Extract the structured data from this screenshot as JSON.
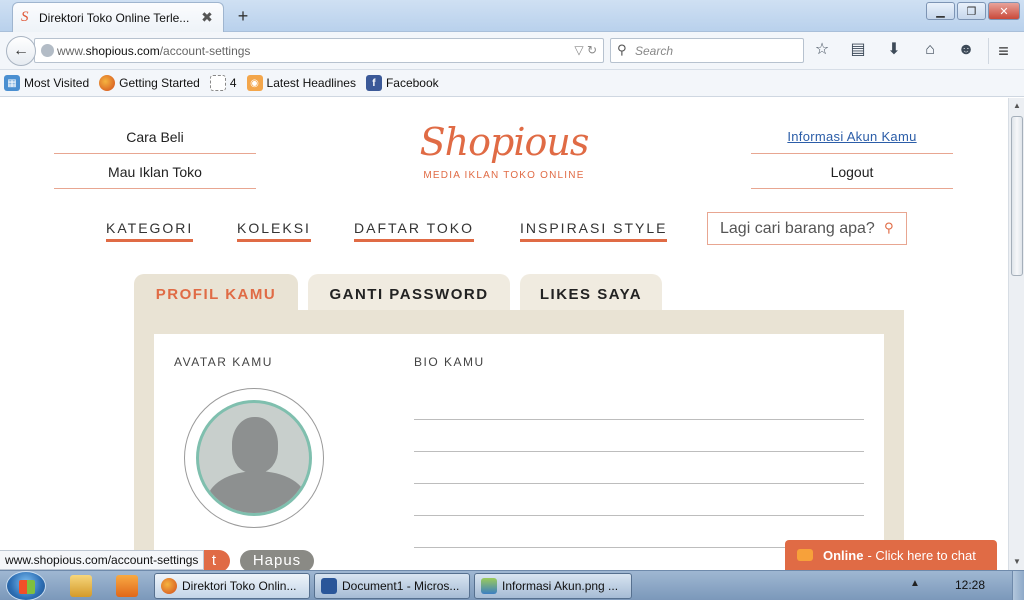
{
  "browser": {
    "tab_title": "Direktori Toko Online Terle...",
    "tab_favicon": "S",
    "tab_close": "✖",
    "new_tab": "+",
    "url_prefix": "www.",
    "url_host": "shopious.com",
    "url_path": "/account-settings",
    "search_placeholder": "Search",
    "bookmarks": [
      {
        "label": "Most Visited",
        "icon": "most-visited-icon"
      },
      {
        "label": "Getting Started",
        "icon": "firefox-icon"
      },
      {
        "label": "4",
        "icon": "folder-icon"
      },
      {
        "label": "Latest Headlines",
        "icon": "rss-icon"
      },
      {
        "label": "Facebook",
        "icon": "facebook-icon"
      }
    ],
    "status_url": "www.shopious.com/account-settings"
  },
  "site": {
    "left_links": [
      "Cara Beli",
      "Mau Iklan Toko"
    ],
    "right_links": [
      "Informasi Akun Kamu",
      "Logout"
    ],
    "logo_text": "Shopious",
    "tagline": "MEDIA IKLAN TOKO ONLINE",
    "nav": [
      "KATEGORI",
      "KOLEKSI",
      "DAFTAR TOKO",
      "INSPIRASI STYLE"
    ],
    "search_placeholder": "Lagi cari barang apa?",
    "profile_tabs": [
      "PROFIL KAMU",
      "GANTI PASSWORD",
      "LIKES SAYA"
    ],
    "avatar_label": "AVATAR KAMU",
    "bio_label": "BIO KAMU",
    "edit_button_fragment": "t",
    "delete_button": "Hapus",
    "chat_status": "Online",
    "chat_text": "- Click here to chat",
    "accent_color": "#e06b45"
  },
  "taskbar": {
    "items": [
      "Direktori Toko Onlin...",
      "Document1 - Micros...",
      "Informasi Akun.png ..."
    ],
    "clock": "12:28"
  }
}
